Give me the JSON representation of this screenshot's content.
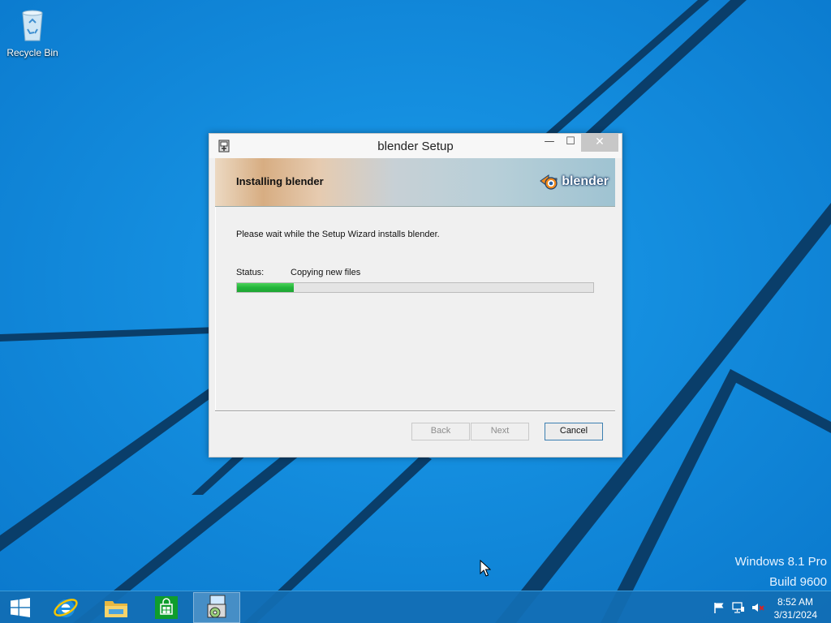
{
  "desktop": {
    "icons": [
      {
        "label": "Recycle Bin",
        "icon": "recycle-bin-icon"
      }
    ],
    "watermark": {
      "line1": "Windows 8.1 Pro",
      "line2": "Build 9600"
    },
    "wallpaper_color": "#0f86d8"
  },
  "setup_window": {
    "title": "blender Setup",
    "icon": "installer-icon",
    "controls": {
      "minimize": "—",
      "maximize": "☐",
      "close": "✕"
    },
    "banner": {
      "title": "Installing blender",
      "logo_text": "blender"
    },
    "message": "Please wait while the Setup Wizard installs blender.",
    "status_label": "Status:",
    "status_value": "Copying new files",
    "progress_fraction": 0.16,
    "progress_color": "#23b53a",
    "buttons": {
      "back": "Back",
      "next": "Next",
      "cancel": "Cancel"
    }
  },
  "taskbar": {
    "items": [
      {
        "name": "start-button",
        "icon": "windows-logo-icon"
      },
      {
        "name": "internet-explorer",
        "icon": "internet-explorer-icon"
      },
      {
        "name": "file-explorer",
        "icon": "folder-icon"
      },
      {
        "name": "store",
        "icon": "store-icon"
      },
      {
        "name": "blender-setup",
        "icon": "installer-icon",
        "active": true
      }
    ],
    "tray": {
      "icons": [
        "flag-icon",
        "network-icon",
        "volume-muted-icon"
      ],
      "time": "8:52 AM",
      "date": "3/31/2024"
    }
  }
}
